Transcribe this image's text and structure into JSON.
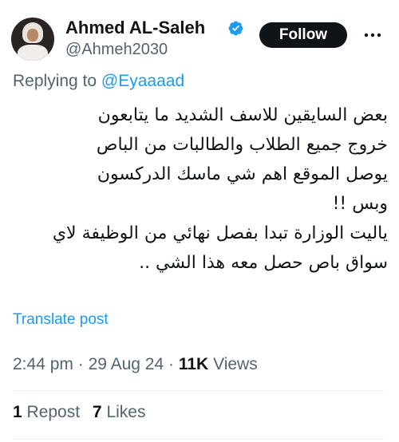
{
  "author": {
    "display_name": "Ahmed AL-Saleh",
    "handle": "@Ahmeh2030",
    "verified": true,
    "avatar_icon": "profile-photo-avatar",
    "verified_icon": "verified-badge-icon",
    "verified_color": "#1d9bf0"
  },
  "actions": {
    "follow_label": "Follow",
    "more_icon": "more-options-icon"
  },
  "reply": {
    "prefix": "Replying to",
    "mention": "@Eyaaaad"
  },
  "tweet": {
    "lines": [
      "بعض السايقين للاسف الشديد ما يتابعون",
      "خروج جميع الطلاب والطالبات من الباص",
      "يوصل الموقع اهم شي ماسك الدركسون",
      "وبس !!",
      "ياليت الوزارة تبدا بفصل نهائي من الوظيفة لاي",
      "سواق باص حصل معه هذا الشي .."
    ],
    "translate_label": "Translate post"
  },
  "meta": {
    "time": "2:44 pm",
    "separator": "·",
    "date": "29 Aug 24",
    "views_count": "11K",
    "views_label": "Views"
  },
  "stats": {
    "reposts_count": "1",
    "reposts_label": "Repost",
    "likes_count": "7",
    "likes_label": "Likes"
  },
  "colors": {
    "accent": "#1d9bf0",
    "text_primary": "#0f1419",
    "text_secondary": "#536471",
    "divider": "#eff3f4"
  }
}
